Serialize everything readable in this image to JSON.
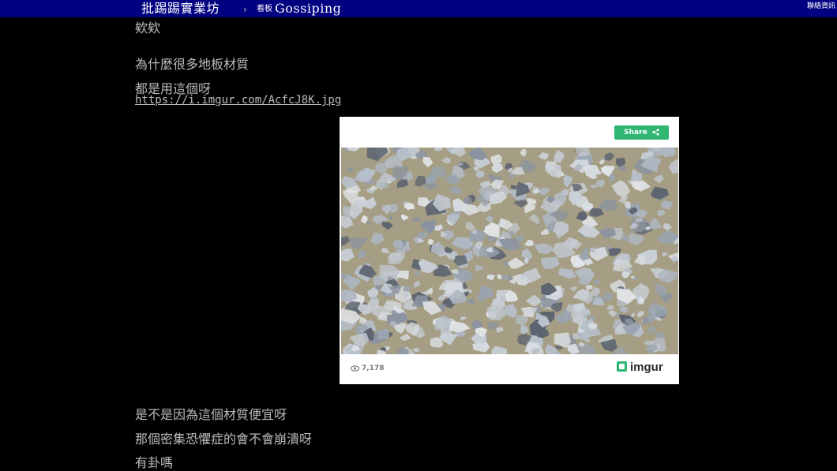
{
  "header": {
    "site_title": "批踢踢實業坊",
    "separator": "›",
    "board_label": "看板",
    "board_name": "Gossiping",
    "right_link": "聯絡資訊"
  },
  "post": {
    "lines_top": [
      "欸欸",
      "為什麼很多地板材質",
      "都是用這個呀"
    ],
    "link_text": "https://i.imgur.com/AcfcJ8K.jpg",
    "lines_bottom": [
      "是不是因為這個材質便宜呀",
      "那個密集恐懼症的會不會崩潰呀",
      "有卦嗎"
    ]
  },
  "embed": {
    "share_label": "Share",
    "views": "7,178",
    "brand": "imgur",
    "image_alt": "terrazzo floor stone texture",
    "colors": {
      "share_green": "#2fb673",
      "stone_base": "#a59e84"
    },
    "icons": [
      "share-icon",
      "eye-icon",
      "imgur-logo-icon"
    ]
  }
}
